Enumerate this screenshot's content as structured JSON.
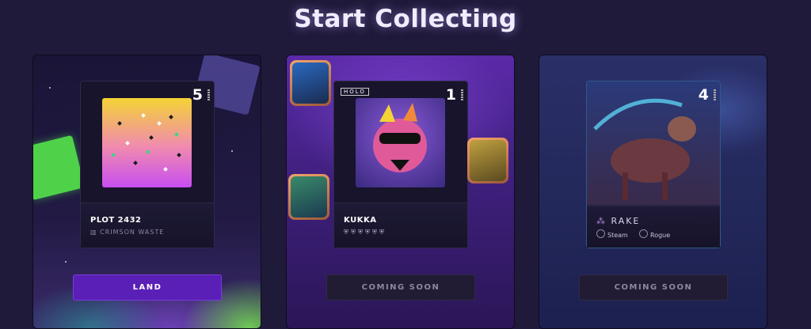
{
  "page": {
    "title": "Start Collecting"
  },
  "cards": [
    {
      "number": "5",
      "name": "PLOT 2432",
      "subtitle": "CRIMSON WASTE",
      "button": "LAND"
    },
    {
      "number": "1",
      "tag": "HOLO",
      "name": "KUKKA",
      "button": "COMING SOON"
    },
    {
      "number": "4",
      "name": "RAKE",
      "traits": [
        "Steam",
        "Rogue"
      ],
      "button": "COMING SOON"
    }
  ],
  "colors": {
    "background": "#1f1a3a",
    "land_button": "#5a1fb6",
    "soon_button": "#211c34"
  }
}
